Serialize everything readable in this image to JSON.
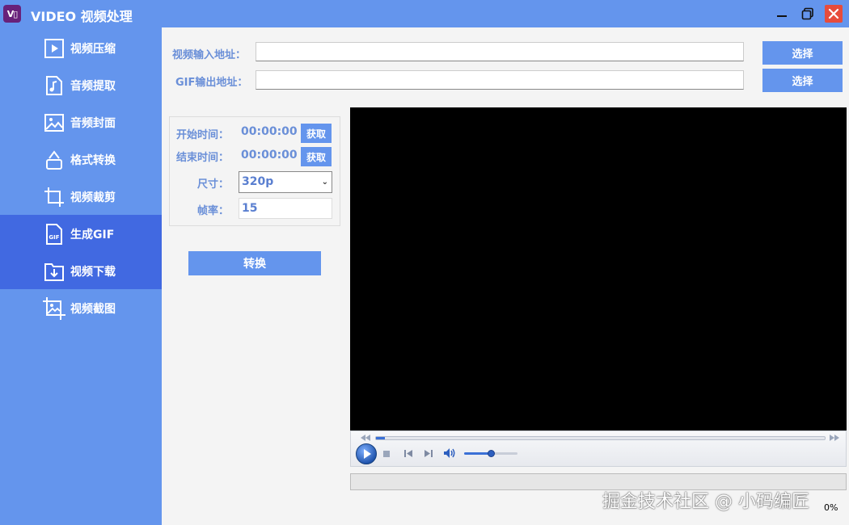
{
  "window": {
    "logo_text": "V▯",
    "title": "VIDEO 视频处理"
  },
  "sidebar": {
    "items": [
      {
        "label": "视频压缩",
        "icon": "play-square-icon"
      },
      {
        "label": "音频提取",
        "icon": "music-note-icon"
      },
      {
        "label": "音频封面",
        "icon": "image-icon"
      },
      {
        "label": "格式转换",
        "icon": "convert-icon"
      },
      {
        "label": "视频裁剪",
        "icon": "crop-icon"
      },
      {
        "label": "生成GIF",
        "icon": "gif-file-icon",
        "active": true
      },
      {
        "label": "视频下载",
        "icon": "download-icon",
        "active": true
      },
      {
        "label": "视频截图",
        "icon": "screenshot-crop-icon"
      }
    ]
  },
  "main": {
    "input_label": "视频输入地址：",
    "input_value": "",
    "output_label": "GIF输出地址：",
    "output_value": "",
    "select_label": "选择",
    "start_label": "开始时间：",
    "start_time": "00:00:00",
    "end_label": "结束时间：",
    "end_time": "00:00:00",
    "get_label": "获取",
    "size_label": "尺寸：",
    "size_value": "320p",
    "fps_label": "帧率：",
    "fps_value": "15",
    "convert_label": "转换"
  },
  "player": {
    "seek_progress": 0.02,
    "volume": 0.5
  },
  "progress": {
    "value": 0,
    "text": "0%"
  },
  "watermark": "掘金技术社区 @ 小码编匠",
  "colors": {
    "accent": "#6495ed",
    "active": "#4169e1",
    "label": "#6a8fd8",
    "close": "#e74c3c"
  }
}
